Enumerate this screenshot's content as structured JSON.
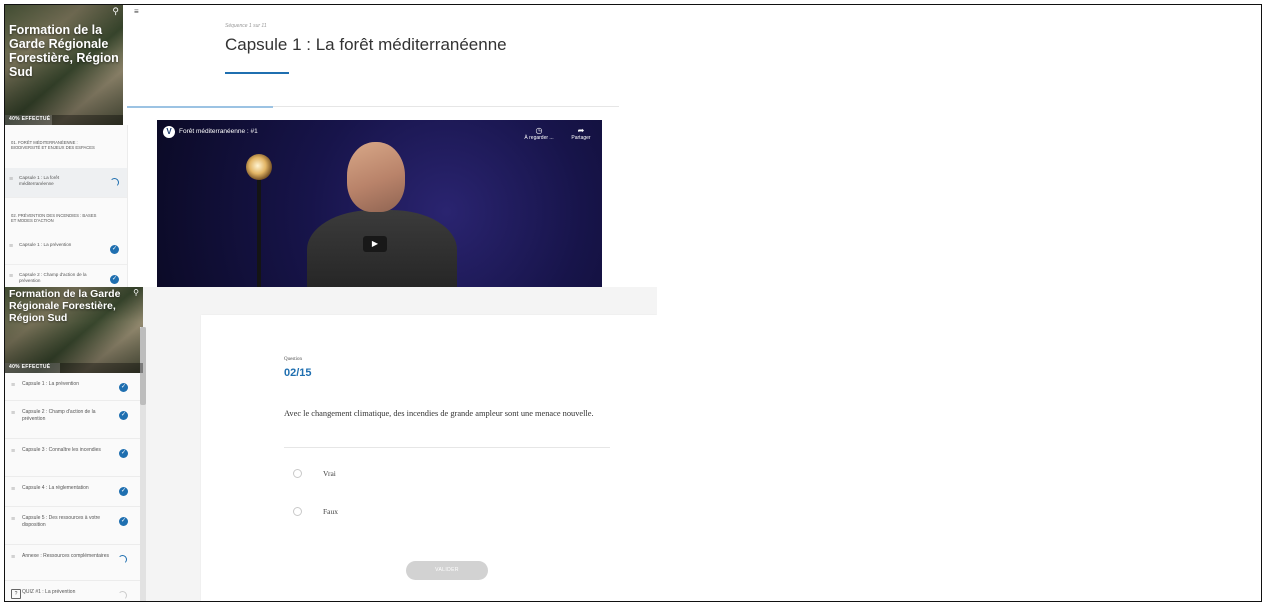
{
  "top_panel": {
    "hero": {
      "title": "Formation de la Garde Régionale Forestière, Région Sud",
      "progress_label": "40% EFFECTUÉ",
      "progress": 0.4
    },
    "sidebar": {
      "sections": [
        {
          "label": "01. FORÊT MÉDITERRANÉENNE : BIODIVERSITÉ ET ENJEUX DES ESPACES"
        },
        {
          "label": "02. PRÉVENTION DES INCENDIES : BASES ET MODES D'ACTION"
        }
      ],
      "items": [
        {
          "label": "Capsule 1 : La forêt méditerranéenne",
          "status": "in-progress"
        },
        {
          "label": "Capsule 1 : La prévention",
          "status": "done"
        },
        {
          "label": "Capsule 2 : Champ d'action de la prévention",
          "status": "done"
        }
      ]
    },
    "lesson": {
      "sequence_label": "Séquence 1 sur 11",
      "title": "Capsule 1 : La forêt méditerranéenne"
    },
    "video": {
      "title": "Forêt méditerranéenne : #1",
      "logo": "V",
      "watch_later": "À regarder ...",
      "share": "Partager"
    }
  },
  "bottom_panel": {
    "hero": {
      "title": "Formation de la Garde Régionale Forestière, Région Sud",
      "progress_label": "40% EFFECTUÉ",
      "progress": 0.4
    },
    "sidebar": {
      "items": [
        {
          "label": "Capsule 1 : La prévention",
          "status": "done"
        },
        {
          "label": "Capsule 2 : Champ d'action de la prévention",
          "status": "done"
        },
        {
          "label": "Capsule 3 : Connaître les incendies",
          "status": "done"
        },
        {
          "label": "Capsule 4 : La réglementation",
          "status": "done"
        },
        {
          "label": "Capsule 5 : Des ressources à votre disposition",
          "status": "done"
        },
        {
          "label": "Annexe : Ressources complémentaires",
          "status": "in-progress"
        },
        {
          "label": "QUIZ #1 : La prévention",
          "status": "not-started"
        }
      ]
    },
    "quiz": {
      "question_label": "Question",
      "question_number": "02/15",
      "question_text": "Avec le changement climatique, des incendies de grande ampleur sont une menace nouvelle.",
      "answers": [
        "Vrai",
        "Faux"
      ],
      "validate_label": "VALIDER"
    }
  },
  "icons": {
    "search": "search-icon",
    "menu": "hamburger-menu-icon",
    "check": "check-circle-icon",
    "progress": "progress-spinner-icon",
    "list": "list-lines-icon",
    "quiz": "quiz-icon",
    "clock": "clock-icon",
    "share": "share-arrow-icon",
    "play": "play-icon"
  },
  "colors": {
    "accent": "#1f6fb0",
    "button_disabled": "#d2d2d2",
    "video_bg": "#17144a"
  }
}
